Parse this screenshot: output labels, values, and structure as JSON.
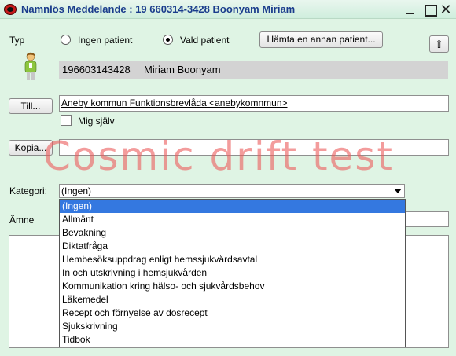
{
  "window": {
    "title": "Namnlös Meddelande :  19 660314-3428 Boonyam Miriam",
    "close_glyph": "✕"
  },
  "typ": {
    "label": "Typ",
    "option_no_patient": "Ingen patient",
    "option_selected_patient": "Vald patient",
    "selected": "Vald patient",
    "fetch_button": "Hämta en annan patient...",
    "up_glyph": "⇧"
  },
  "patient": {
    "id": "196603143428",
    "name": "Miriam Boonyam"
  },
  "recipient": {
    "to_button": "Till...",
    "to_value": "Aneby kommun Funktionsbrevlåda <anebykomnmun>",
    "self_checkbox_label": "Mig själv",
    "self_checked": false,
    "copy_button": "Kopia...",
    "copy_value": ""
  },
  "watermark": "Cosmic drift test",
  "category": {
    "label": "Kategori:",
    "value": "(Ingen)",
    "options": [
      "(Ingen)",
      "Allmänt",
      "Bevakning",
      "Diktatfråga",
      "Hembesöksuppdrag enligt hemssjukvårdsavtal",
      "In och utskrivning i hemsjukvården",
      "Kommunikation kring hälso- och sjukvårdsbehov",
      "Läkemedel",
      "Recept och förnyelse av dosrecept",
      "Sjukskrivning",
      "Tidbok"
    ],
    "selected_index": 0
  },
  "subject": {
    "label": "Ämne",
    "value": ""
  },
  "colors": {
    "background": "#dff4e4",
    "title_text": "#1a3c8c",
    "selection": "#3478e0",
    "watermark": "#ec5f5f"
  }
}
